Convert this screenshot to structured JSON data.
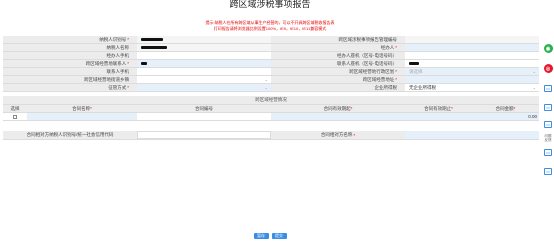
{
  "page": {
    "title": "跨区域涉税事项报告",
    "note_line1": "提示:纳税人在所有跨区域从事生产经营的，可以不开具跨区域税收报告表",
    "note_line2": "打印报告请将浏览器比例设置100%，IE9，IE10，IE11兼容模式"
  },
  "fields": [
    {
      "label": "纳税人识别号",
      "required": true,
      "value": "",
      "redacted": true
    },
    {
      "label": "跨区域涉税事项报告管理编号",
      "required": false,
      "value": ""
    },
    {
      "label": "纳税人名称",
      "required": false,
      "value": "",
      "redacted": true
    },
    {
      "label": "经办人",
      "required": true,
      "value": ""
    },
    {
      "label": "经办人手机",
      "required": false,
      "value": ""
    },
    {
      "label": "经办人座机（区号-电话号码）",
      "required": false,
      "value": ""
    },
    {
      "label": "跨区域经营地联系人",
      "required": true,
      "value": "",
      "redacted": true
    },
    {
      "label": "联系人座机（区号-电话号码）",
      "required": false,
      "value": "",
      "redacted": true
    },
    {
      "label": "联系人手机",
      "required": false,
      "value": ""
    },
    {
      "label": "跨区域经营地行政区划",
      "required": true,
      "value": "请选择"
    },
    {
      "label": "跨区域经营地街道乡镇",
      "required": false,
      "value": ""
    },
    {
      "label": "跨区域经营地址",
      "required": true,
      "value": ""
    },
    {
      "label": "征管方式",
      "required": true,
      "value": ""
    },
    {
      "label": "企业所得税",
      "required": false,
      "value": "无企业所得税"
    }
  ],
  "contract": {
    "section_title": "跨区域经营情况",
    "columns": [
      "选择",
      "合同名称",
      "合同编号",
      "合同有效期起",
      "合同有效期止",
      "合同金额"
    ],
    "required_columns": [
      false,
      true,
      false,
      true,
      true,
      true
    ],
    "row": {
      "amount": "0.00"
    },
    "buyer_tin_label": "合同相对方纳税人识别号/统一社会信用代码",
    "buyer_name_label": "合同相对方名称"
  },
  "buttons": {
    "save": "暂存",
    "submit": "提交"
  },
  "side": {
    "wechat": "微信",
    "weibo": "微博",
    "online_text": "问题\n反馈"
  },
  "colors": {
    "accent": "#3a8ee6",
    "required": "#e60000",
    "wechat": "#2bb24c",
    "weibo": "#e6162d"
  }
}
